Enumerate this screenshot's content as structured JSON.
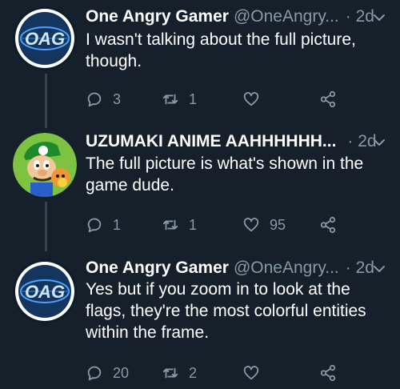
{
  "tweets": [
    {
      "name": "One Angry Gamer",
      "handle": "@OneAngry...",
      "time": "· 2d",
      "text": "I wasn't talking about the full picture, though.",
      "replies": "3",
      "retweets": "1",
      "likes": ""
    },
    {
      "name": "UZUMAKI ANIME AAHHHHHH...",
      "handle": "",
      "time": "· 2d",
      "text": "The full picture is what's shown in the game dude.",
      "replies": "1",
      "retweets": "1",
      "likes": "95"
    },
    {
      "name": "One Angry Gamer",
      "handle": "@OneAngry...",
      "time": "· 2d",
      "text": "Yes but if you zoom in to look at the flags, they're the most colorful entities within the frame.",
      "replies": "20",
      "retweets": "2",
      "likes": ""
    }
  ],
  "avatar_logo_text": "OAG",
  "colors": {
    "background": "#15202b",
    "muted": "#8899a6",
    "thread_line": "#38444d"
  }
}
